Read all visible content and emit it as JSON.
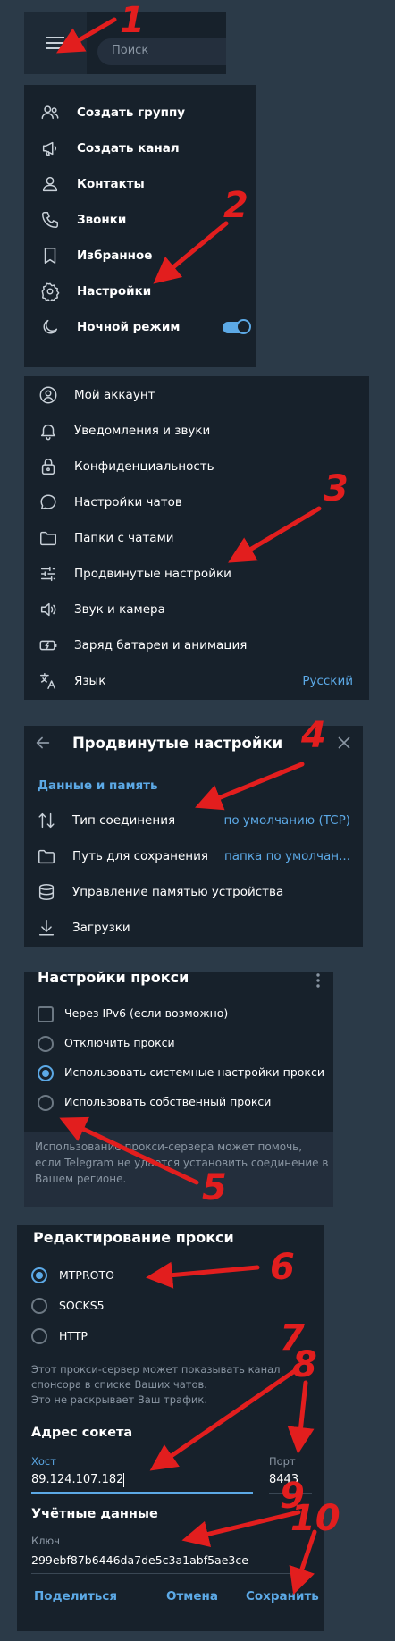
{
  "search": {
    "placeholder": "Поиск"
  },
  "menu": {
    "items": [
      {
        "label": "Создать группу",
        "icon": "group-icon"
      },
      {
        "label": "Создать канал",
        "icon": "megaphone-icon"
      },
      {
        "label": "Контакты",
        "icon": "contact-icon"
      },
      {
        "label": "Звонки",
        "icon": "phone-icon"
      },
      {
        "label": "Избранное",
        "icon": "bookmark-icon"
      },
      {
        "label": "Настройки",
        "icon": "gear-icon"
      },
      {
        "label": "Ночной режим",
        "icon": "moon-icon"
      }
    ],
    "night_mode_on": true
  },
  "settings": {
    "items": [
      {
        "label": "Мой аккаунт",
        "icon": "account-icon"
      },
      {
        "label": "Уведомления и звуки",
        "icon": "bell-icon"
      },
      {
        "label": "Конфиденциальность",
        "icon": "lock-icon"
      },
      {
        "label": "Настройки чатов",
        "icon": "chat-icon"
      },
      {
        "label": "Папки с чатами",
        "icon": "folder-icon"
      },
      {
        "label": "Продвинутые настройки",
        "icon": "sliders-icon"
      },
      {
        "label": "Звук и камера",
        "icon": "speaker-icon"
      },
      {
        "label": "Заряд батареи и анимация",
        "icon": "battery-icon"
      },
      {
        "label": "Язык",
        "icon": "language-icon",
        "value": "Русский"
      }
    ]
  },
  "advanced": {
    "title": "Продвинутые настройки",
    "section": "Данные и память",
    "items": [
      {
        "label": "Тип соединения",
        "icon": "arrows-updown-icon",
        "value": "по умолчанию (TCP)"
      },
      {
        "label": "Путь для сохранения",
        "icon": "folder-icon",
        "value": "папка по умолчан..."
      },
      {
        "label": "Управление памятью устройства",
        "icon": "database-icon"
      },
      {
        "label": "Загрузки",
        "icon": "download-icon"
      }
    ]
  },
  "proxy": {
    "title": "Настройки прокси",
    "ipv6": "Через IPv6 (если возможно)",
    "options": [
      {
        "label": "Отключить прокси",
        "selected": false
      },
      {
        "label": "Использовать системные настройки прокси",
        "selected": true
      },
      {
        "label": "Использовать собственный прокси",
        "selected": false
      }
    ],
    "note_lines": [
      "Использование прокси-сервера может помочь,",
      "если Telegram не удается установить соединение в",
      "Вашем регионе."
    ]
  },
  "edit": {
    "title": "Редактирование прокси",
    "types": [
      {
        "label": "MTPROTO",
        "selected": true
      },
      {
        "label": "SOCKS5",
        "selected": false
      },
      {
        "label": "HTTP",
        "selected": false
      }
    ],
    "note_lines": [
      "Этот прокси-сервер может показывать канал",
      "спонсора в списке Ваших чатов.",
      "Это не раскрывает Ваш трафик."
    ],
    "socket_heading": "Адрес сокета",
    "host_label": "Хост",
    "host_value": "89.124.107.182",
    "port_label": "Порт",
    "port_value": "8443",
    "creds_heading": "Учётные данные",
    "key_label": "Ключ",
    "key_value": "299ebf87b6446da7de5c3a1abf5ae3ce",
    "share": "Поделиться",
    "cancel": "Отмена",
    "save": "Сохранить"
  },
  "annotations": [
    "1",
    "2",
    "3",
    "4",
    "5",
    "6",
    "7",
    "8",
    "9",
    "10"
  ],
  "colors": {
    "panel": "#17212b",
    "background": "#2b3a48",
    "accent": "#5ca9e6",
    "arrow": "#e21e1e"
  }
}
